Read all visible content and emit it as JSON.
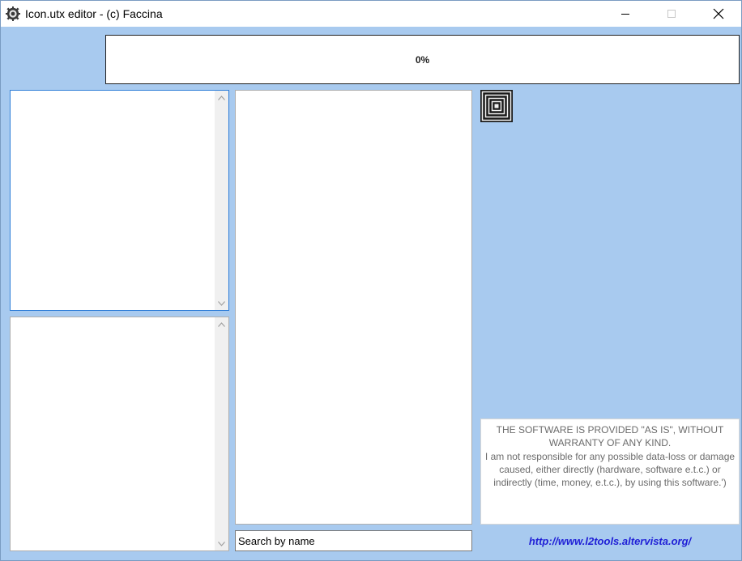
{
  "window": {
    "title": "Icon.utx editor - (c) Faccina",
    "icon": "gear-icon",
    "controls": {
      "minimize": "minimize-icon",
      "maximize": "maximize-icon",
      "close": "close-icon"
    }
  },
  "progress": {
    "label": "0%",
    "value": 0
  },
  "lists": {
    "packages": {
      "items": []
    },
    "groups": {
      "items": []
    },
    "textures": {
      "items": []
    }
  },
  "search": {
    "placeholder": "Search by name",
    "value": ""
  },
  "preview": {
    "icon": "texture-preview-icon"
  },
  "disclaimer": {
    "text": "THE SOFTWARE IS PROVIDED \"AS IS\", WITHOUT WARRANTY OF ANY KIND.\nI am not responsible for any possible data-loss or damage caused, either directly (hardware, software e.t.c.) or indirectly (time, money, e.t.c.), by using this software.')"
  },
  "website": {
    "label": "http://www.l2tools.altervista.org/"
  },
  "colors": {
    "background": "#a8caef",
    "link": "#1f1fd6",
    "focus_border": "#2f7ed8",
    "disclaimer_text": "#6b6b6b"
  }
}
